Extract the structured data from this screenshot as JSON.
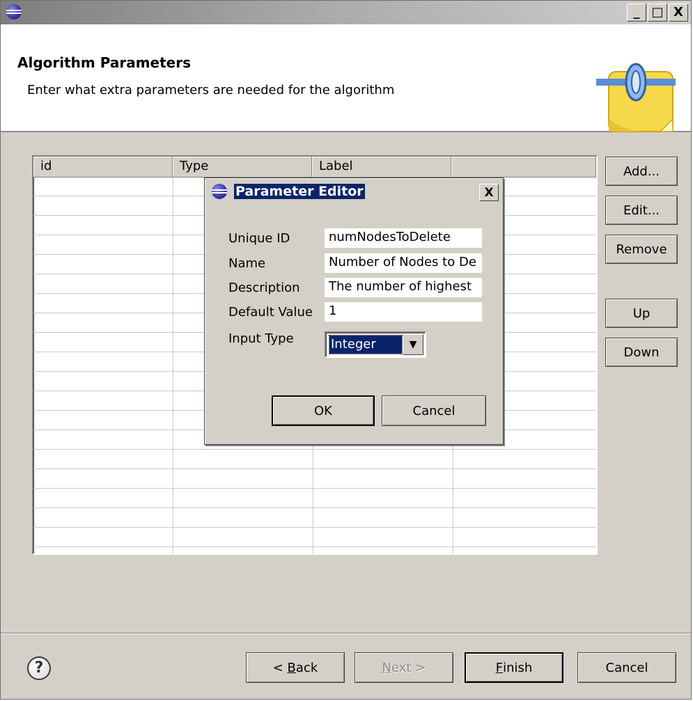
{
  "window": {
    "title": "",
    "icon": "eclipse-icon",
    "controls": [
      "_",
      "□",
      "X"
    ]
  },
  "banner": {
    "title": "Algorithm Parameters",
    "description": "Enter what extra parameters are needed for the algorithm",
    "icon": "plugin-connector-icon"
  },
  "table": {
    "columns": [
      "id",
      "Type",
      "Label",
      ""
    ],
    "rows": []
  },
  "side_buttons": {
    "add": "Add...",
    "edit": "Edit...",
    "remove": "Remove",
    "up": "Up",
    "down": "Down"
  },
  "dialog": {
    "title": "Parameter Editor",
    "close": "X",
    "fields": {
      "unique_id": {
        "label": "Unique ID",
        "value": "numNodesToDelete"
      },
      "name": {
        "label": "Name",
        "value": "Number of Nodes to De"
      },
      "description": {
        "label": "Description",
        "value": "The number of highest"
      },
      "default_value": {
        "label": "Default Value",
        "value": "1"
      },
      "input_type": {
        "label": "Input Type",
        "value": "Integer"
      }
    },
    "ok": "OK",
    "cancel": "Cancel"
  },
  "footer": {
    "help_icon": "?",
    "back": {
      "pre": "< ",
      "mnemonic": "B",
      "post": "ack"
    },
    "next": {
      "mnemonic": "N",
      "post": "ext >"
    },
    "finish": {
      "mnemonic": "F",
      "post": "inish"
    },
    "cancel": "Cancel"
  }
}
